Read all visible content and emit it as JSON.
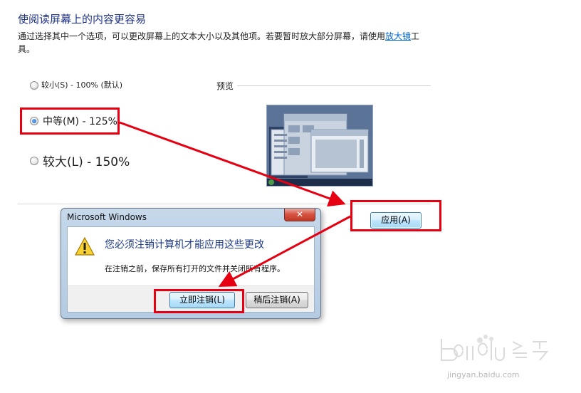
{
  "page": {
    "title": "使阅读屏幕上的内容更容易",
    "description_prefix": "通过选择其中一个选项，可以更改屏幕上的文本大小以及其他项。若要暂时放大部分屏幕，请使用",
    "magnifier_link": "放大镜",
    "description_suffix": "工具。"
  },
  "options": [
    {
      "label": "较小(S) - 100% (默认)",
      "selected": false
    },
    {
      "label": "中等(M) - 125%",
      "selected": true
    },
    {
      "label": "较大(L) - 150%",
      "selected": false
    }
  ],
  "preview": {
    "label": "预览"
  },
  "apply_button": {
    "label": "应用(A)"
  },
  "dialog": {
    "title": "Microsoft Windows",
    "close_glyph": "✕",
    "heading": "您必须注销计算机才能应用这些更改",
    "message": "在注销之前，保存所有打开的文件并关闭所有程序。",
    "logoff_now": "立即注销(L)",
    "logoff_later": "稍后注销(A)"
  },
  "watermark": {
    "brand": "Bai du 经验",
    "site": "jingyan.baidu.com"
  },
  "colors": {
    "highlight": "#e60012",
    "title": "#1e3287",
    "link": "#0066cc"
  }
}
